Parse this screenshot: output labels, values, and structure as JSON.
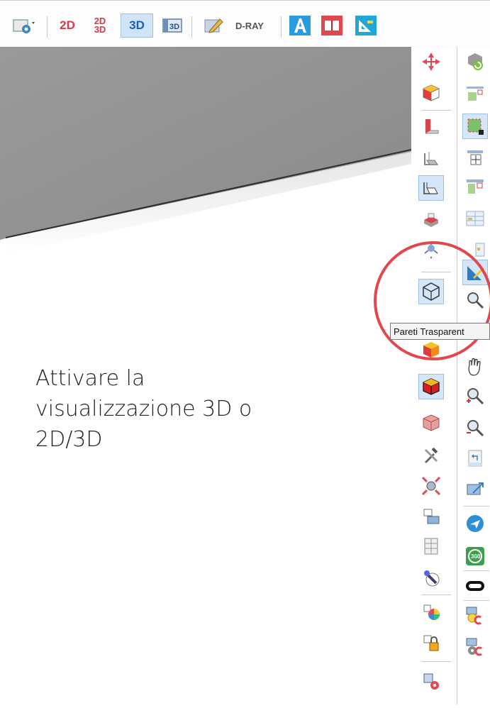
{
  "toolbar": {
    "btn_2d": "2D",
    "btn_2d3d_top": "2D",
    "btn_2d3d_bottom": "3D",
    "btn_3d": "3D",
    "btn_3d_panel": "3D",
    "btn_dray": "D-RAY"
  },
  "tooltip": {
    "text": "Pareti Trasparent"
  },
  "caption": {
    "line1": "Attivare la",
    "line2": "visualizzazione 3D o",
    "line3": "2D/3D"
  },
  "colors": {
    "accent_red": "#e2474f",
    "active_blue": "#d4e6f8",
    "wall_gray": "#8e8e8e"
  },
  "left_toolstrip": [
    "move-icon",
    "color-cube-icon",
    "wall-section-icon",
    "floor-box-icon",
    "room-box-icon",
    "cut-plane-icon",
    "camera-axes-icon",
    "transparent-walls-icon",
    "hidden-icon",
    "yellow-cube-icon",
    "red-cube-icon",
    "render-cube-icon",
    "tools-icon",
    "zoom-fit-icon",
    "layout-icon",
    "furniture-icon",
    "material-icon",
    "color-wheel-icon",
    "lock-object-icon",
    "settings-object-icon"
  ],
  "right_toolstrip": [
    "refresh-icon",
    "ceiling-icon",
    "select-area-icon",
    "snap-icon",
    "beam-icon",
    "table-icon",
    "partial-icon",
    "measure-icon",
    "zoom-window-icon",
    "pan-hand-icon",
    "zoom-in-icon",
    "zoom-out-icon",
    "undo-view-icon",
    "3d-view-icon",
    "walk-icon",
    "rotate-360-icon",
    "line-icon",
    "light-icon",
    "light-settings-icon"
  ]
}
